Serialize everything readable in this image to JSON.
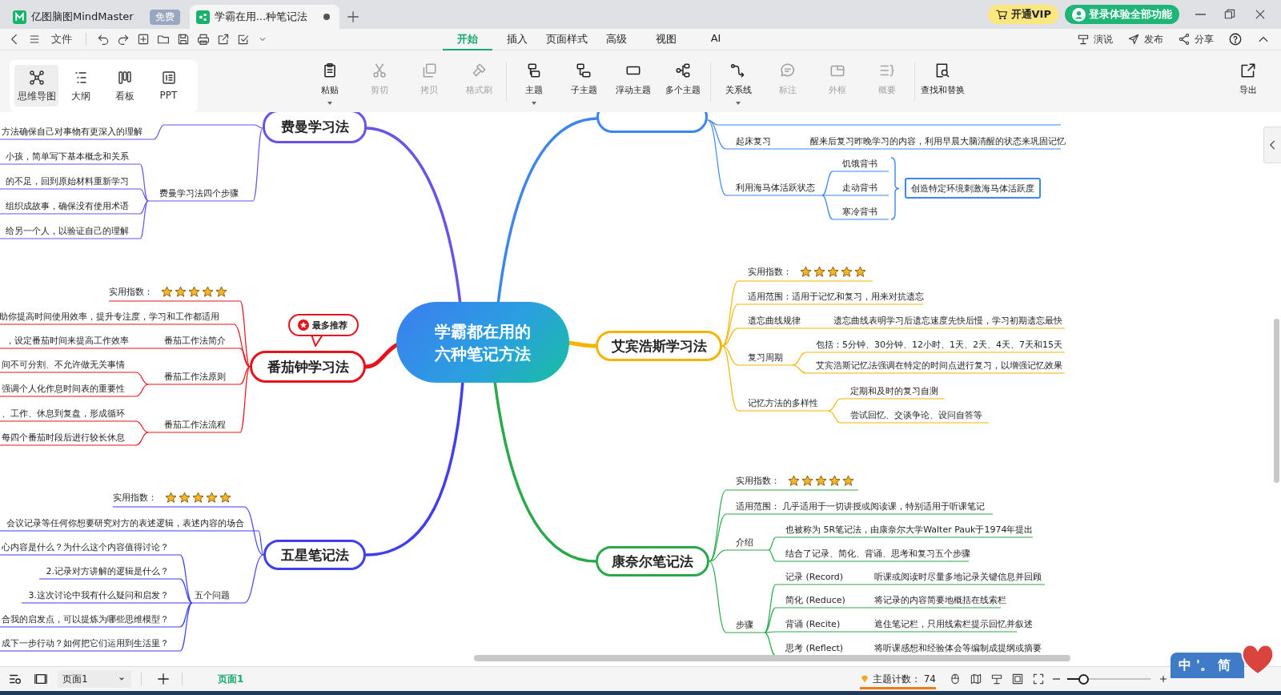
{
  "app_tabs": [
    {
      "label": "亿图脑图MindMaster",
      "badge": "免费",
      "selected": false
    },
    {
      "label": "学霸在用...种笔记法",
      "modified": true,
      "selected": true
    }
  ],
  "title_actions": [
    {
      "kind": "vip",
      "label": "开通VIP"
    },
    {
      "kind": "login",
      "label": "登录体验全部功能"
    }
  ],
  "menu": {
    "file": "文件",
    "tabs": [
      {
        "label": "开始",
        "selected": true
      },
      {
        "label": "插入",
        "selected": false
      },
      {
        "label": "页面样式",
        "selected": false
      },
      {
        "label": "高级",
        "selected": false
      },
      {
        "label": "视图",
        "selected": false
      },
      {
        "label": "AI",
        "selected": false
      }
    ],
    "actions": [
      "演说",
      "发布",
      "分享"
    ]
  },
  "toolbar": {
    "views": [
      {
        "label": "思维导图",
        "selected": true
      },
      {
        "label": "大纲",
        "selected": false
      },
      {
        "label": "看板",
        "selected": false
      },
      {
        "label": "PPT",
        "selected": false
      }
    ],
    "groups": [
      [
        {
          "label": "粘贴",
          "disabled": false,
          "dropdown": true
        },
        {
          "label": "剪切",
          "disabled": true,
          "dropdown": false
        },
        {
          "label": "拷贝",
          "disabled": true,
          "dropdown": false
        },
        {
          "label": "格式刷",
          "disabled": true,
          "dropdown": false
        }
      ],
      [
        {
          "label": "主题",
          "disabled": false,
          "dropdown": true
        },
        {
          "label": "子主题",
          "disabled": false,
          "dropdown": false
        },
        {
          "label": "浮动主题",
          "disabled": false,
          "dropdown": false
        },
        {
          "label": "多个主题",
          "disabled": false,
          "dropdown": false
        }
      ],
      [
        {
          "label": "关系线",
          "disabled": false,
          "dropdown": true
        },
        {
          "label": "标注",
          "disabled": true,
          "dropdown": false
        },
        {
          "label": "外框",
          "disabled": true,
          "dropdown": false
        },
        {
          "label": "概要",
          "disabled": true,
          "dropdown": false
        }
      ],
      [
        {
          "label": "查找和替换",
          "disabled": false,
          "dropdown": false
        }
      ]
    ],
    "export": "导出"
  },
  "mindmap": {
    "center": [
      "学霸都在用的",
      "六种笔记方法"
    ],
    "branches": [
      {
        "title": "费曼学习法",
        "color": "#6b52e6",
        "topics": [
          {
            "kind": "topic",
            "children": [
              {
                "text": "方法确保自己对事物有更深入的理解"
              }
            ]
          },
          {
            "kind": "topic",
            "text": "费曼学习法四个步骤",
            "children": [
              {
                "text": "小孩，简单写下基本概念和关系"
              },
              {
                "text": "的不足，回到原始材料重新学习"
              },
              {
                "text": "组织成故事，确保没有使用术语"
              },
              {
                "text": "给另一个人，以验证自己的理解"
              }
            ]
          }
        ]
      },
      {
        "title": "番茄钟学习法",
        "color": "#e5141b",
        "badge": "最多推荐",
        "topics": [
          {
            "kind": "rating",
            "text": "实用指数：",
            "stars": 5
          },
          {
            "kind": "topic",
            "text": "助你提高时间使用效率，提升专注度，学习和工作都适用"
          },
          {
            "kind": "topic",
            "text": "番茄工作法简介",
            "children": [
              {
                "text": "，设定番茄时间来提高工作效率"
              }
            ]
          },
          {
            "kind": "topic",
            "text": "番茄工作法原则",
            "children": [
              {
                "text": "间不可分割、不允许做无关事情"
              },
              {
                "text": "强调个人化作息时间表的重要性"
              }
            ]
          },
          {
            "kind": "topic",
            "text": "番茄工作法流程",
            "children": [
              {
                "text": "、工作、休息到复盘，形成循环"
              },
              {
                "text": "每四个番茄时段后进行较长休息"
              }
            ]
          }
        ]
      },
      {
        "title": "五星笔记法",
        "color": "#3f3ff0",
        "topics": [
          {
            "kind": "rating",
            "text": "实用指数：",
            "stars": 5
          },
          {
            "kind": "topic",
            "text": "会议记录等任何你想要研究对方的表述逻辑，表述内容的场合"
          },
          {
            "kind": "topic",
            "text": "五个问题",
            "children": [
              {
                "text": "心内容是什么？为什么这个内容值得讨论？"
              },
              {
                "text": "2.记录对方讲解的逻辑是什么？"
              },
              {
                "text": "3.这次讨论中我有什么疑问和启发？"
              },
              {
                "text": "合我的启发点，可以提炼为哪些思维模型？"
              },
              {
                "text": "成下一步行动？如何把它们运用到生活里？"
              }
            ]
          }
        ]
      },
      {
        "color": "#3d86f0",
        "topics": [
          {
            "kind": "topic"
          },
          {
            "kind": "topic",
            "text": "起床复习",
            "children": [
              {
                "text": "醒来后复习昨晚学习的内容，利用早晨大脑清醒的状态来巩固记忆"
              }
            ]
          },
          {
            "kind": "topic",
            "text": "利用海马体活跃状态",
            "summary": "创造特定环境刺激海马体活跃度",
            "children": [
              {
                "text": "饥饿背书"
              },
              {
                "text": "走动背书"
              },
              {
                "text": "寒冷背书"
              }
            ]
          }
        ]
      },
      {
        "title": "艾宾浩斯学习法",
        "color": "#f5b400",
        "topics": [
          {
            "kind": "rating",
            "text": "实用指数：",
            "stars": 5
          },
          {
            "kind": "topic",
            "text": "适用范围：适用于记忆和复习，用来对抗遗忘"
          },
          {
            "kind": "topic",
            "text": "遗忘曲线规律",
            "children": [
              {
                "text": "遗忘曲线表明学习后遗忘速度先快后慢，学习初期遗忘最快"
              }
            ]
          },
          {
            "kind": "topic",
            "text": "复习周期",
            "children": [
              {
                "text": "包括：5分钟、30分钟、12小时、1天、2天、4天、7天和15天"
              },
              {
                "text": "艾宾浩斯记忆法强调在特定的时间点进行复习，以增强记忆效果"
              }
            ]
          },
          {
            "kind": "topic",
            "text": "记忆方法的多样性",
            "children": [
              {
                "text": "定期和及时的复习自测"
              },
              {
                "text": "尝试回忆、交谈争论、设问自答等"
              }
            ]
          }
        ]
      },
      {
        "title": "康奈尔笔记法",
        "color": "#2aa84a",
        "topics": [
          {
            "kind": "rating",
            "text": "实用指数：",
            "stars": 5
          },
          {
            "kind": "topic",
            "text": "适用范围： 几乎适用于一切讲授或阅读课，特别适用于听课笔记"
          },
          {
            "kind": "topic",
            "text": "介绍",
            "children": [
              {
                "text": "也被称为 5R笔记法，由康奈尔大学Walter Pauk于1974年提出"
              },
              {
                "text": "结合了记录、简化、背诵、思考和复习五个步骤"
              }
            ]
          },
          {
            "kind": "topic",
            "text": "步骤",
            "children": [
              {
                "text": "记录 (Record)",
                "children": [
                  {
                    "text": "听课或阅读时尽量多地记录关键信息并回顾"
                  }
                ]
              },
              {
                "text": "简化 (Reduce)",
                "children": [
                  {
                    "text": "将记录的内容简要地概括在线索栏"
                  }
                ]
              },
              {
                "text": "背诵 (Recite)",
                "children": [
                  {
                    "text": "遮住笔记栏，只用线索栏提示回忆并叙述"
                  }
                ]
              },
              {
                "text": "思考 (Reflect)",
                "children": [
                  {
                    "text": "将听课感想和经验体会等编制成提纲或摘要"
                  }
                ]
              }
            ]
          }
        ]
      }
    ]
  },
  "status_bar": {
    "page_select": "页面1",
    "page_tab": "页面1",
    "topic_count_label": "主题计数：",
    "topic_count": "74",
    "zoom_slider": {
      "level": 0.2
    }
  },
  "ime": [
    "中",
    "'。",
    "简"
  ]
}
